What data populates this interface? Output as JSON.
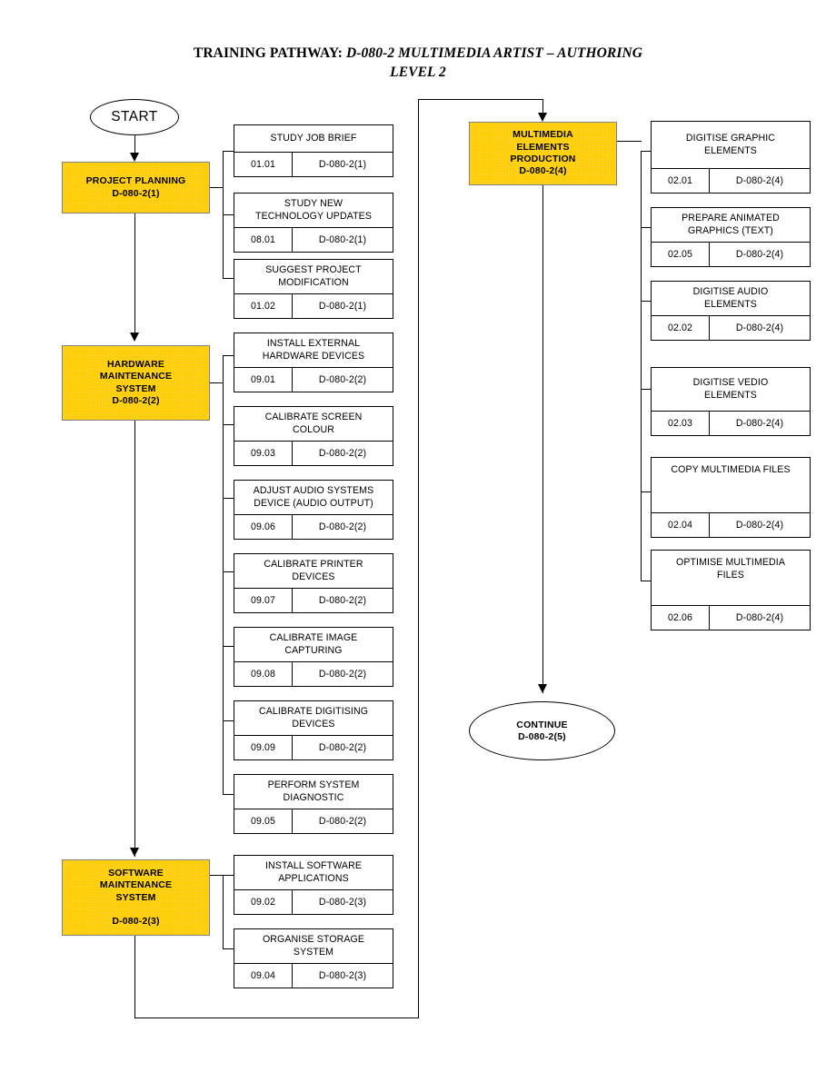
{
  "title": {
    "label": "TRAINING PATHWAY:",
    "name_line1": "D-080-2 MULTIMEDIA ARTIST – AUTHORING",
    "name_line2": "LEVEL 2"
  },
  "colors": {
    "module_fill": "#FFCC00",
    "module_border": "#808080",
    "line": "#000000",
    "box_fill": "#FFFFFF"
  },
  "terminators": {
    "start": {
      "text": "START"
    },
    "continue": {
      "line1": "CONTINUE",
      "line2": "D-080-2(5)"
    }
  },
  "modules": [
    {
      "id": "project-planning",
      "lines": [
        "PROJECT PLANNING",
        "D-080-2(1)"
      ],
      "code": "D-080-2(1)"
    },
    {
      "id": "hardware-maintenance-system",
      "lines": [
        "HARDWARE",
        "MAINTENANCE",
        "SYSTEM",
        "D-080-2(2)"
      ],
      "code": "D-080-2(2)"
    },
    {
      "id": "software-maintenance-system",
      "lines": [
        "SOFTWARE",
        "MAINTENANCE",
        "SYSTEM"
      ],
      "code": "D-080-2(3)"
    },
    {
      "id": "multimedia-elements-production",
      "lines": [
        "MULTIMEDIA",
        "ELEMENTS",
        "PRODUCTION",
        "D-080-2(4)"
      ],
      "code": "D-080-2(4)"
    }
  ],
  "tasks_project_planning": [
    {
      "title_line1": "STUDY JOB BRIEF",
      "title_line2": "",
      "code": "01.01",
      "ref": "D-080-2(1)"
    },
    {
      "title_line1": "STUDY NEW",
      "title_line2": "TECHNOLOGY UPDATES",
      "code": "08.01",
      "ref": "D-080-2(1)"
    },
    {
      "title_line1": "SUGGEST PROJECT",
      "title_line2": "MODIFICATION",
      "code": "01.02",
      "ref": "D-080-2(1)"
    }
  ],
  "tasks_hardware": [
    {
      "title_line1": "INSTALL EXTERNAL",
      "title_line2": "HARDWARE DEVICES",
      "code": "09.01",
      "ref": "D-080-2(2)"
    },
    {
      "title_line1": "CALIBRATE SCREEN",
      "title_line2": "COLOUR",
      "code": "09.03",
      "ref": "D-080-2(2)"
    },
    {
      "title_line1": "ADJUST AUDIO SYSTEMS",
      "title_line2": "DEVICE (AUDIO OUTPUT)",
      "code": "09.06",
      "ref": "D-080-2(2)"
    },
    {
      "title_line1": "CALIBRATE PRINTER",
      "title_line2": "DEVICES",
      "code": "09.07",
      "ref": "D-080-2(2)"
    },
    {
      "title_line1": "CALIBRATE IMAGE",
      "title_line2": "CAPTURING",
      "code": "09.08",
      "ref": "D-080-2(2)"
    },
    {
      "title_line1": "CALIBRATE DIGITISING",
      "title_line2": "DEVICES",
      "code": "09.09",
      "ref": "D-080-2(2)"
    },
    {
      "title_line1": "PERFORM SYSTEM",
      "title_line2": "DIAGNOSTIC",
      "code": "09.05",
      "ref": "D-080-2(2)"
    }
  ],
  "tasks_software": [
    {
      "title_line1": "INSTALL SOFTWARE",
      "title_line2": "APPLICATIONS",
      "code": "09.02",
      "ref": "D-080-2(3)"
    },
    {
      "title_line1": "ORGANISE STORAGE",
      "title_line2": "SYSTEM",
      "code": "09.04",
      "ref": "D-080-2(3)"
    }
  ],
  "tasks_multimedia": [
    {
      "title_line1": "DIGITISE GRAPHIC",
      "title_line2": "ELEMENTS",
      "code": "02.01",
      "ref": "D-080-2(4)"
    },
    {
      "title_line1": "PREPARE ANIMATED",
      "title_line2": "GRAPHICS (TEXT)",
      "code": "02.05",
      "ref": "D-080-2(4)"
    },
    {
      "title_line1": "DIGITISE AUDIO",
      "title_line2": "ELEMENTS",
      "code": "02.02",
      "ref": "D-080-2(4)"
    },
    {
      "title_line1": "DIGITISE VEDIO",
      "title_line2": "ELEMENTS",
      "code": "02.03",
      "ref": "D-080-2(4)"
    },
    {
      "title_line1": "COPY MULTIMEDIA FILES",
      "title_line2": "",
      "code": "02.04",
      "ref": "D-080-2(4)"
    },
    {
      "title_line1": "OPTIMISE MULTIMEDIA",
      "title_line2": "FILES",
      "code": "02.06",
      "ref": "D-080-2(4)"
    }
  ]
}
